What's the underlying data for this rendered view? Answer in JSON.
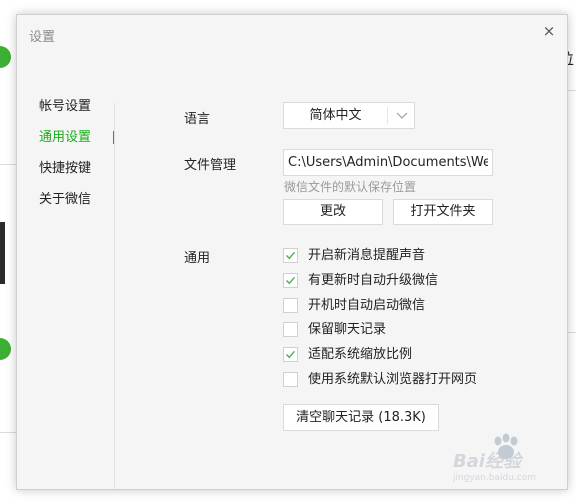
{
  "dialog": {
    "title": "设置",
    "close_glyph": "×"
  },
  "background": {
    "right_text_fragment": "位"
  },
  "sidebar": {
    "items": [
      {
        "label": "帐号设置",
        "active": false
      },
      {
        "label": "通用设置",
        "active": true
      },
      {
        "label": "快捷按键",
        "active": false
      },
      {
        "label": "关于微信",
        "active": false
      }
    ]
  },
  "general": {
    "language_label": "语言",
    "language_value": "简体中文",
    "file_mgmt_label": "文件管理",
    "file_path_value": "C:\\Users\\Admin\\Documents\\WeChat Files",
    "file_path_hint": "微信文件的默认保存位置",
    "change_button": "更改",
    "open_folder_button": "打开文件夹",
    "general_label": "通用",
    "options": [
      {
        "label": "开启新消息提醒声音",
        "checked": true
      },
      {
        "label": "有更新时自动升级微信",
        "checked": true
      },
      {
        "label": "开机时自动启动微信",
        "checked": false
      },
      {
        "label": "保留聊天记录",
        "checked": false
      },
      {
        "label": "适配系统缩放比例",
        "checked": true
      },
      {
        "label": "使用系统默认浏览器打开网页",
        "checked": false
      }
    ],
    "clear_history_button": "清空聊天记录 (18.3K)"
  },
  "watermark": {
    "text": "Bai经验",
    "subtext": "jingyan.baidu.com"
  },
  "colors": {
    "accent": "#1aad19",
    "check": "#4caf50",
    "dialog_bg": "#f5f5f5",
    "border": "#dadada"
  },
  "icons": {
    "close": "close-icon",
    "dropdown": "chevron-down-icon",
    "check": "checkmark-icon",
    "paw": "paw-icon"
  }
}
